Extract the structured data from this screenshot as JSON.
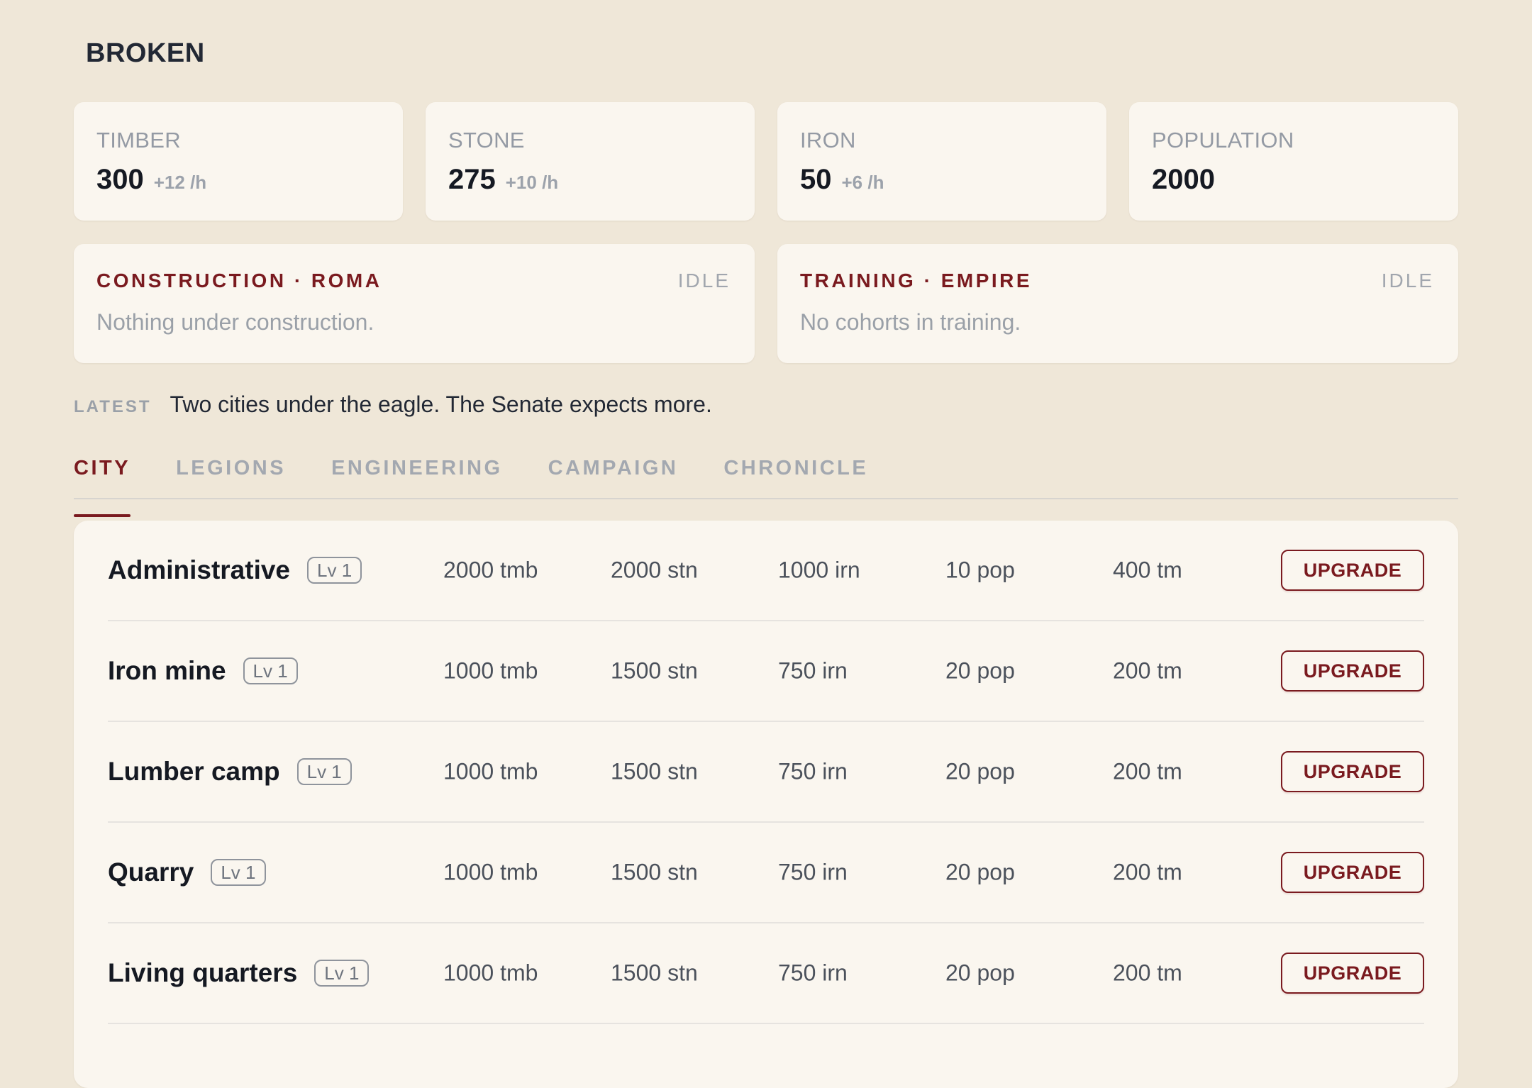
{
  "app": {
    "title": "BROKEN"
  },
  "resources": [
    {
      "label": "TIMBER",
      "value": "300",
      "rate": "+12 /h"
    },
    {
      "label": "STONE",
      "value": "275",
      "rate": "+10 /h"
    },
    {
      "label": "IRON",
      "value": "50",
      "rate": "+6 /h"
    },
    {
      "label": "POPULATION",
      "value": "2000",
      "rate": ""
    }
  ],
  "queues": {
    "construction": {
      "title": "CONSTRUCTION · ROMA",
      "status": "IDLE",
      "message": "Nothing under construction."
    },
    "training": {
      "title": "TRAINING · EMPIRE",
      "status": "IDLE",
      "message": "No cohorts in training."
    }
  },
  "latest": {
    "label": "LATEST",
    "text": "Two cities under the eagle. The Senate expects more."
  },
  "tabs": [
    {
      "label": "CITY",
      "active": true
    },
    {
      "label": "LEGIONS",
      "active": false
    },
    {
      "label": "ENGINEERING",
      "active": false
    },
    {
      "label": "CAMPAIGN",
      "active": false
    },
    {
      "label": "CHRONICLE",
      "active": false
    }
  ],
  "buildings": [
    {
      "name": "Administrative",
      "level": "Lv 1",
      "timber": "2000 tmb",
      "stone": "2000 stn",
      "iron": "1000 irn",
      "pop": "10 pop",
      "time": "400 tm",
      "action": "UPGRADE"
    },
    {
      "name": "Iron mine",
      "level": "Lv 1",
      "timber": "1000 tmb",
      "stone": "1500 stn",
      "iron": "750 irn",
      "pop": "20 pop",
      "time": "200 tm",
      "action": "UPGRADE"
    },
    {
      "name": "Lumber camp",
      "level": "Lv 1",
      "timber": "1000 tmb",
      "stone": "1500 stn",
      "iron": "750 irn",
      "pop": "20 pop",
      "time": "200 tm",
      "action": "UPGRADE"
    },
    {
      "name": "Quarry",
      "level": "Lv 1",
      "timber": "1000 tmb",
      "stone": "1500 stn",
      "iron": "750 irn",
      "pop": "20 pop",
      "time": "200 tm",
      "action": "UPGRADE"
    },
    {
      "name": "Living quarters",
      "level": "Lv 1",
      "timber": "1000 tmb",
      "stone": "1500 stn",
      "iron": "750 irn",
      "pop": "20 pop",
      "time": "200 tm",
      "action": "UPGRADE"
    }
  ],
  "colors": {
    "background": "#efe7d8",
    "card": "#faf6ef",
    "accent": "#7a1a1f",
    "muted": "#9aa0a8"
  }
}
